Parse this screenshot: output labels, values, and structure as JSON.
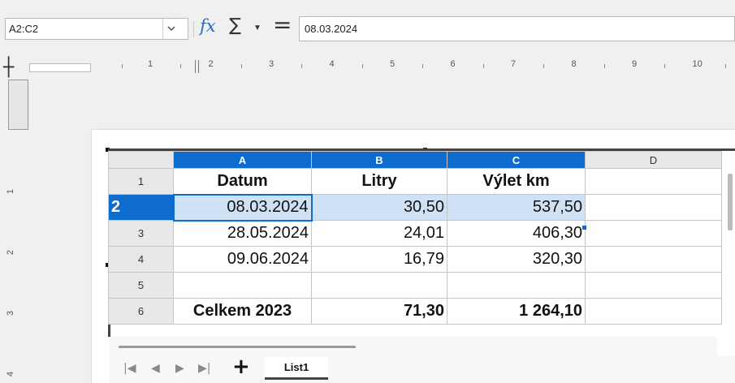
{
  "formula_bar": {
    "name_box": "A2:C2",
    "fx_label": "fx",
    "sum_label": "∑",
    "equals_label": "=",
    "formula": "08.03.2024"
  },
  "ruler": {
    "numbers": [
      "1",
      "2",
      "3",
      "4",
      "5",
      "6",
      "7",
      "8",
      "9",
      "10"
    ]
  },
  "vruler": {
    "numbers": [
      "1",
      "2",
      "3",
      "4"
    ]
  },
  "sheet": {
    "columns": [
      "A",
      "B",
      "C",
      "D"
    ],
    "rows": [
      {
        "num": "1",
        "a": "Datum",
        "b": "Litry",
        "c": "Výlet km",
        "d": ""
      },
      {
        "num": "2",
        "a": "08.03.2024",
        "b": "30,50",
        "c": "537,50",
        "d": ""
      },
      {
        "num": "3",
        "a": "28.05.2024",
        "b": "24,01",
        "c": "406,30",
        "d": ""
      },
      {
        "num": "4",
        "a": "09.06.2024",
        "b": "16,79",
        "c": "320,30",
        "d": ""
      },
      {
        "num": "5",
        "a": "",
        "b": "",
        "c": "",
        "d": ""
      },
      {
        "num": "6",
        "a": "Celkem 2023",
        "b": "71,30",
        "c": "1 264,10",
        "d": ""
      }
    ]
  },
  "tabs": {
    "sheet_tab": "List1",
    "add_label": "+"
  },
  "colors": {
    "selection_header": "#0f6ccf",
    "selection_fill": "#cfe1f5"
  }
}
